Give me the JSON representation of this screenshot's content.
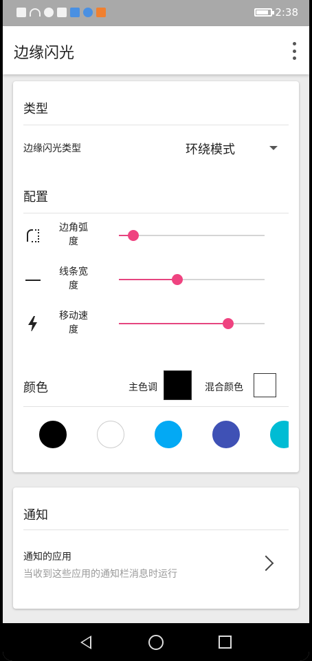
{
  "status_bar": {
    "time": "2:38",
    "battery_fraction": 0.85
  },
  "app_bar": {
    "title": "边缘闪光",
    "overflow_icon": "more-vertical-icon"
  },
  "type_section": {
    "title": "类型",
    "setting_label": "边缘闪光类型",
    "selected_value": "环绕模式"
  },
  "config_section": {
    "title": "配置",
    "sliders": [
      {
        "icon": "corner-radius-icon",
        "label_line1": "边角弧",
        "label_line2": "度",
        "value_fraction": 0.1
      },
      {
        "icon": "line-width-icon",
        "label_line1": "线条宽",
        "label_line2": "度",
        "value_fraction": 0.4
      },
      {
        "icon": "lightning-icon",
        "label_line1": "移动速",
        "label_line2": "度",
        "value_fraction": 0.75
      }
    ]
  },
  "color_section": {
    "title": "颜色",
    "primary_label": "主色调",
    "primary_color": "#000000",
    "mix_label": "混合颜色",
    "mix_color": "#ffffff",
    "swatches": [
      "#000000",
      "#ffffff",
      "#03a9f4",
      "#3f51b5",
      "#00bcd4"
    ]
  },
  "notify_section": {
    "title": "通知",
    "item_title": "通知的应用",
    "item_subtitle": "当收到这些应用的通知栏消息时运行"
  },
  "accent_color": "#ef4380"
}
